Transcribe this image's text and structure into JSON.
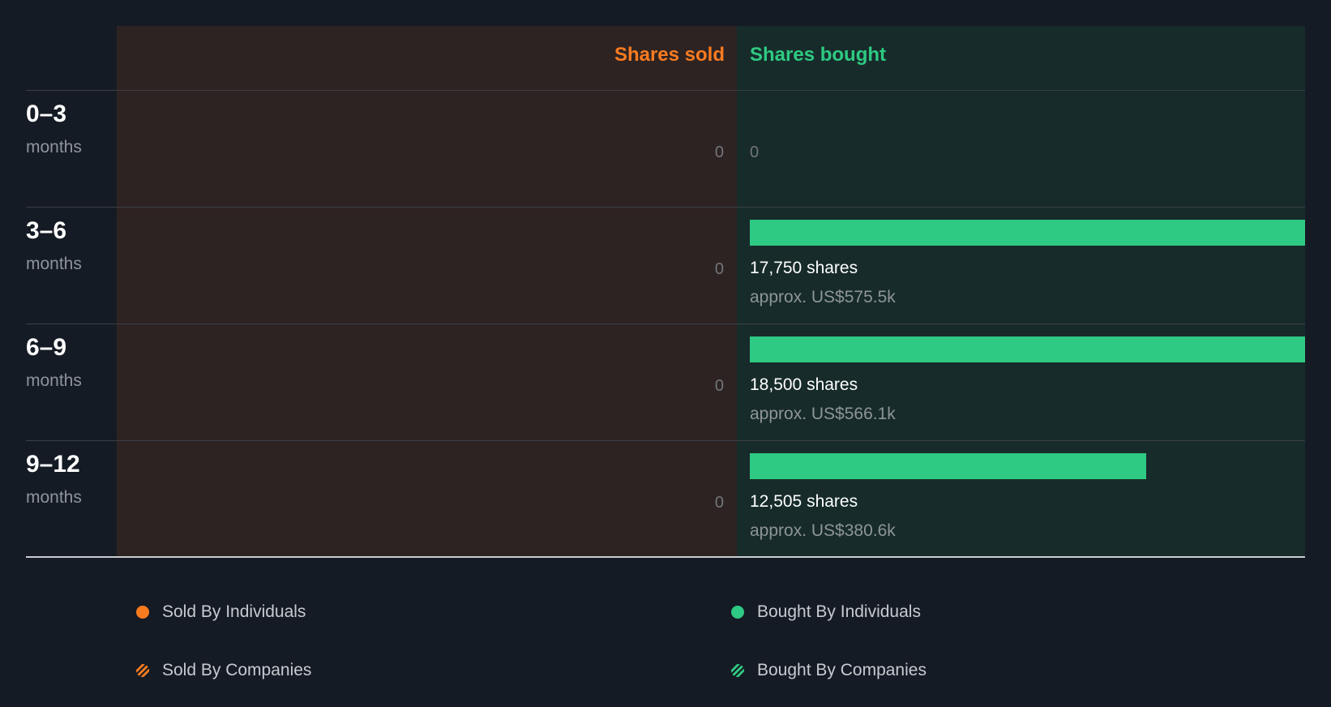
{
  "colors": {
    "sold": "#f97b20",
    "bought": "#2ec982",
    "sold_bg": "#2d2322",
    "bought_bg": "#172b2b"
  },
  "chart_data": {
    "type": "bar",
    "orientation": "horizontal-diverging",
    "headers": {
      "sold": "Shares sold",
      "bought": "Shares bought"
    },
    "rows": [
      {
        "period": "0–3",
        "unit": "months",
        "sold_label": "0",
        "sold": 0,
        "bought": 0,
        "bought_label": "0",
        "bought_shares": "",
        "bought_value": ""
      },
      {
        "period": "3–6",
        "unit": "months",
        "sold_label": "0",
        "sold": 0,
        "bought": 17750,
        "bought_label": "",
        "bought_shares": "17,750 shares",
        "bought_value": "approx. US$575.5k"
      },
      {
        "period": "6–9",
        "unit": "months",
        "sold_label": "0",
        "sold": 0,
        "bought": 18500,
        "bought_label": "",
        "bought_shares": "18,500 shares",
        "bought_value": "approx. US$566.1k"
      },
      {
        "period": "9–12",
        "unit": "months",
        "sold_label": "0",
        "sold": 0,
        "bought": 12505,
        "bought_label": "",
        "bought_shares": "12,505 shares",
        "bought_value": "approx. US$380.6k"
      }
    ],
    "bar_max": 17500,
    "legend": [
      {
        "label": "Sold By Individuals",
        "icon": "dot",
        "color": "#f97b20"
      },
      {
        "label": "Bought By Individuals",
        "icon": "dot",
        "color": "#2ec982"
      },
      {
        "label": "Sold By Companies",
        "icon": "hatched-dot",
        "color": "#f97b20"
      },
      {
        "label": "Bought By Companies",
        "icon": "hatched-dot",
        "color": "#2ec982"
      }
    ]
  }
}
